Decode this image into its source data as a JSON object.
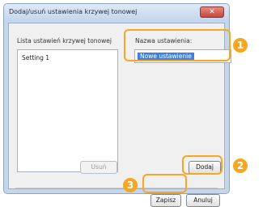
{
  "window": {
    "title": "Dodaj/usuń ustawienia krzywej tonowej",
    "close_glyph": "✕"
  },
  "list_panel": {
    "label": "Lista ustawień krzywej tonowej",
    "items": [
      "Setting 1"
    ],
    "delete_label": "Usuń"
  },
  "name_panel": {
    "label": "Nazwa ustawienia:",
    "value": "Nowe ustawienie"
  },
  "buttons": {
    "add_label": "Dodaj",
    "save_label": "Zapisz",
    "cancel_label": "Anuluj"
  },
  "callouts": [
    "1",
    "2",
    "3"
  ],
  "colors": {
    "callout": "#f6a623",
    "selection": "#3f80dd"
  }
}
